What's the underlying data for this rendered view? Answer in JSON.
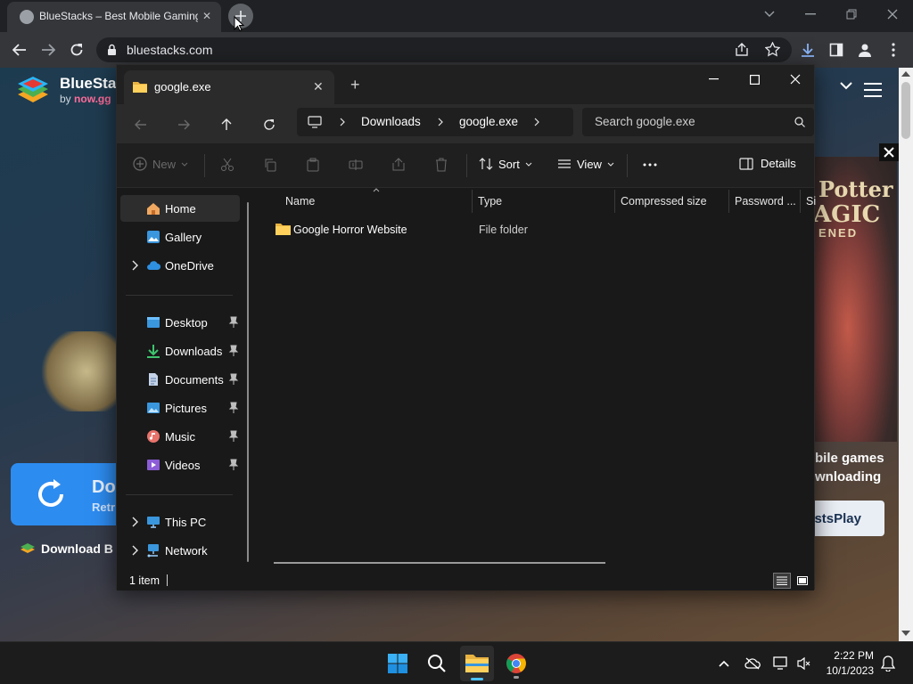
{
  "browser": {
    "tab_title": "BlueStacks – Best Mobile Gaming Platform",
    "url": "bluestacks.com"
  },
  "page": {
    "brand_name": "BlueStacks",
    "brand_by_prefix": "by",
    "brand_by_name": "now.gg",
    "banner_title": "Do",
    "banner_sub": "Retr",
    "download_link": "Download B",
    "game_title_1": "Potter",
    "game_title_2": "AGIC",
    "game_title_3": "ENED",
    "promo_line1": "bile games",
    "promo_line2": "wnloading",
    "promo_button": "stsPlay",
    "brand_color": "#2d8cf0"
  },
  "explorer": {
    "tab_title": "google.exe",
    "breadcrumb": [
      "Downloads",
      "google.exe"
    ],
    "search_placeholder": "Search google.exe",
    "commands": {
      "new": "New",
      "sort": "Sort",
      "view": "View",
      "details": "Details"
    },
    "nav": {
      "home": "Home",
      "gallery": "Gallery",
      "onedrive": "OneDrive",
      "desktop": "Desktop",
      "downloads": "Downloads",
      "documents": "Documents",
      "pictures": "Pictures",
      "music": "Music",
      "videos": "Videos",
      "thispc": "This PC",
      "network": "Network"
    },
    "columns": [
      "Name",
      "Type",
      "Compressed size",
      "Password ...",
      "Si"
    ],
    "rows": [
      {
        "name": "Google Horror Website",
        "type": "File folder"
      }
    ],
    "status": "1 item"
  },
  "taskbar": {
    "time": "2:22 PM",
    "date": "10/1/2023"
  }
}
